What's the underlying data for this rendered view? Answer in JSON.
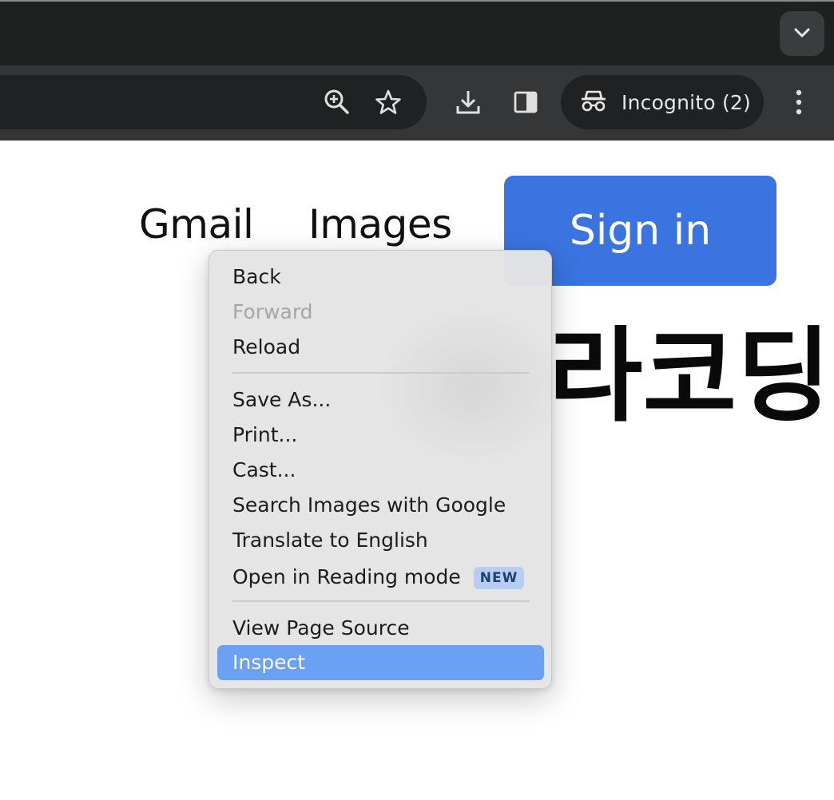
{
  "browser": {
    "profile_label": "Incognito (2)",
    "toolbar_icons": [
      "zoom-in-icon",
      "star-icon",
      "download-icon",
      "side-panel-icon",
      "incognito-icon",
      "more-vertical-icon"
    ],
    "tab_search_icon": "chevron-down-icon"
  },
  "page": {
    "nav": {
      "gmail": "Gmail",
      "images": "Images"
    },
    "signin_label": "Sign in",
    "hero_text": "라코딩",
    "colors": {
      "signin_bg": "#3a74e0"
    }
  },
  "context_menu": {
    "items": [
      {
        "label": "Back",
        "enabled": true
      },
      {
        "label": "Forward",
        "enabled": false
      },
      {
        "label": "Reload",
        "enabled": true
      },
      {
        "label": "Save As...",
        "enabled": true
      },
      {
        "label": "Print...",
        "enabled": true
      },
      {
        "label": "Cast...",
        "enabled": true
      },
      {
        "label": "Search Images with Google",
        "enabled": true
      },
      {
        "label": "Translate to English",
        "enabled": true
      },
      {
        "label": "Open in Reading mode",
        "enabled": true,
        "badge": "NEW"
      },
      {
        "label": "View Page Source",
        "enabled": true
      },
      {
        "label": "Inspect",
        "enabled": true,
        "highlighted": true
      }
    ],
    "colors": {
      "highlight": "#6aa1f5",
      "badge_bg": "#b8cdf3"
    }
  }
}
